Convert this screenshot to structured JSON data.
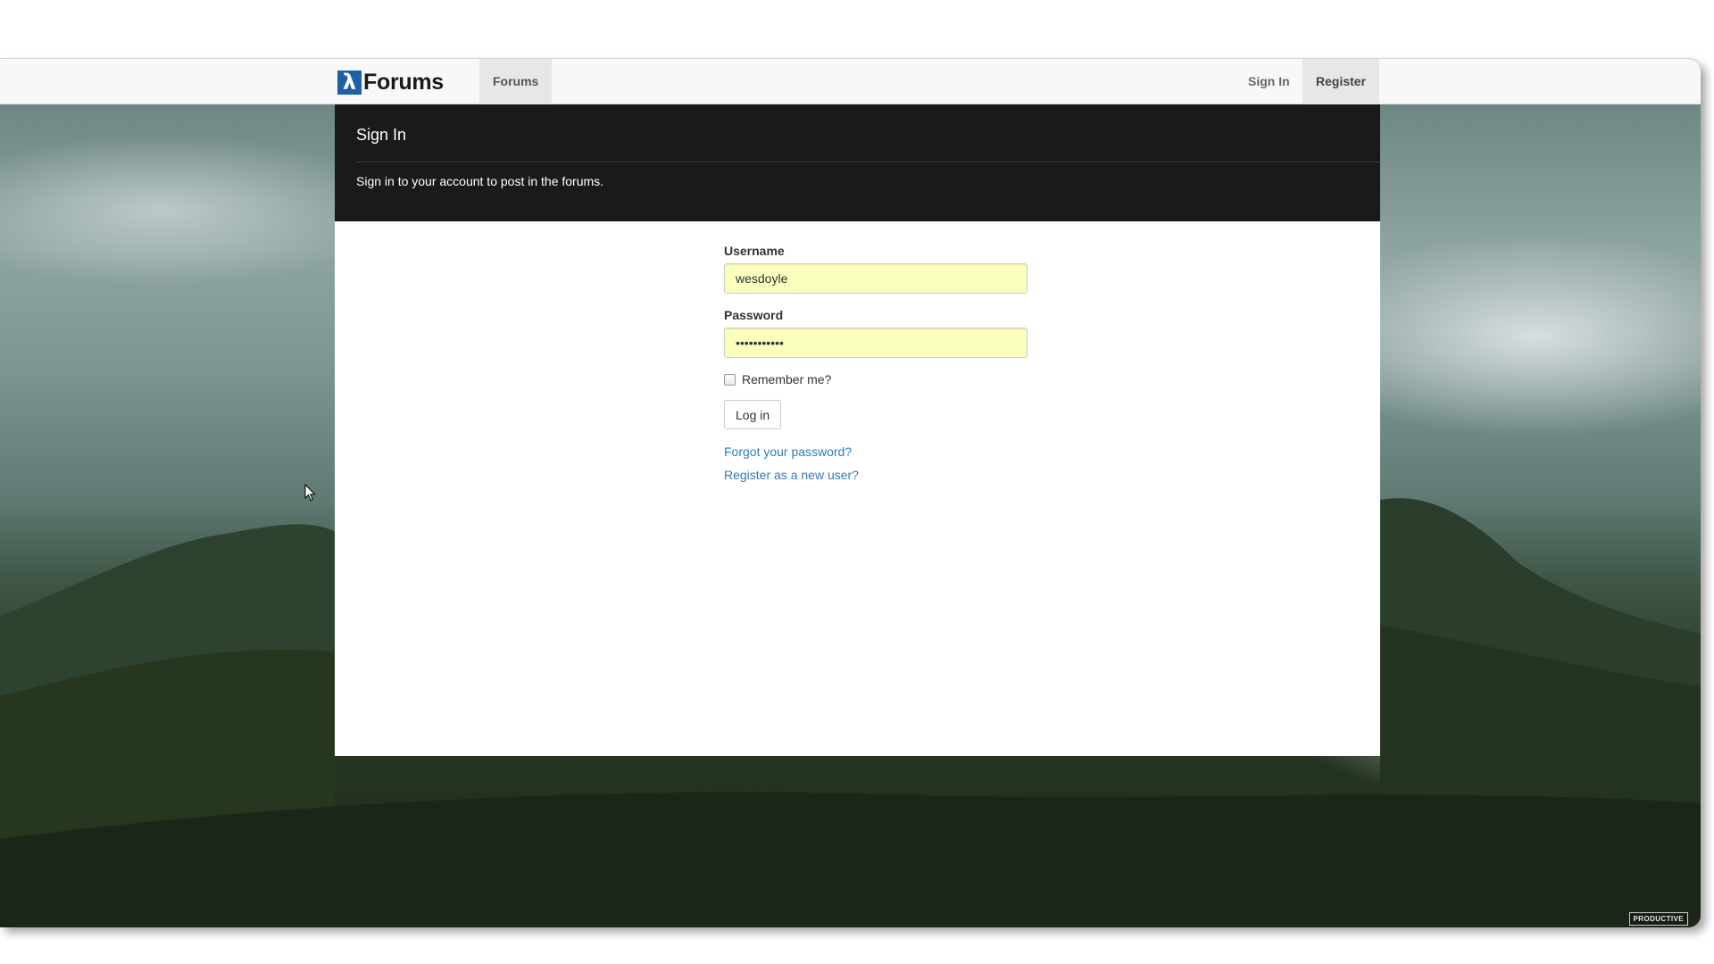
{
  "navbar": {
    "brand_logo": "λ",
    "brand_text": "Forums",
    "links": {
      "forums": "Forums",
      "sign_in": "Sign In",
      "register": "Register"
    }
  },
  "header": {
    "title": "Sign In",
    "subtitle": "Sign in to your account to post in the forums."
  },
  "form": {
    "username_label": "Username",
    "username_value": "wesdoyle",
    "password_label": "Password",
    "password_value": "•••••••••••",
    "remember_label": "Remember me?",
    "remember_checked": false,
    "login_button": "Log in",
    "forgot_link": "Forgot your password?",
    "register_link": "Register as a new user?"
  },
  "watermark": "PRODUCTIVE",
  "colors": {
    "autofill_bg": "#faffbd",
    "link": "#337ab7",
    "header_band": "#1a1a1c",
    "brand_logo": "#1f5fa8"
  },
  "icons": {
    "cursor": "mouse-pointer-icon",
    "checkbox": "checkbox-icon"
  }
}
